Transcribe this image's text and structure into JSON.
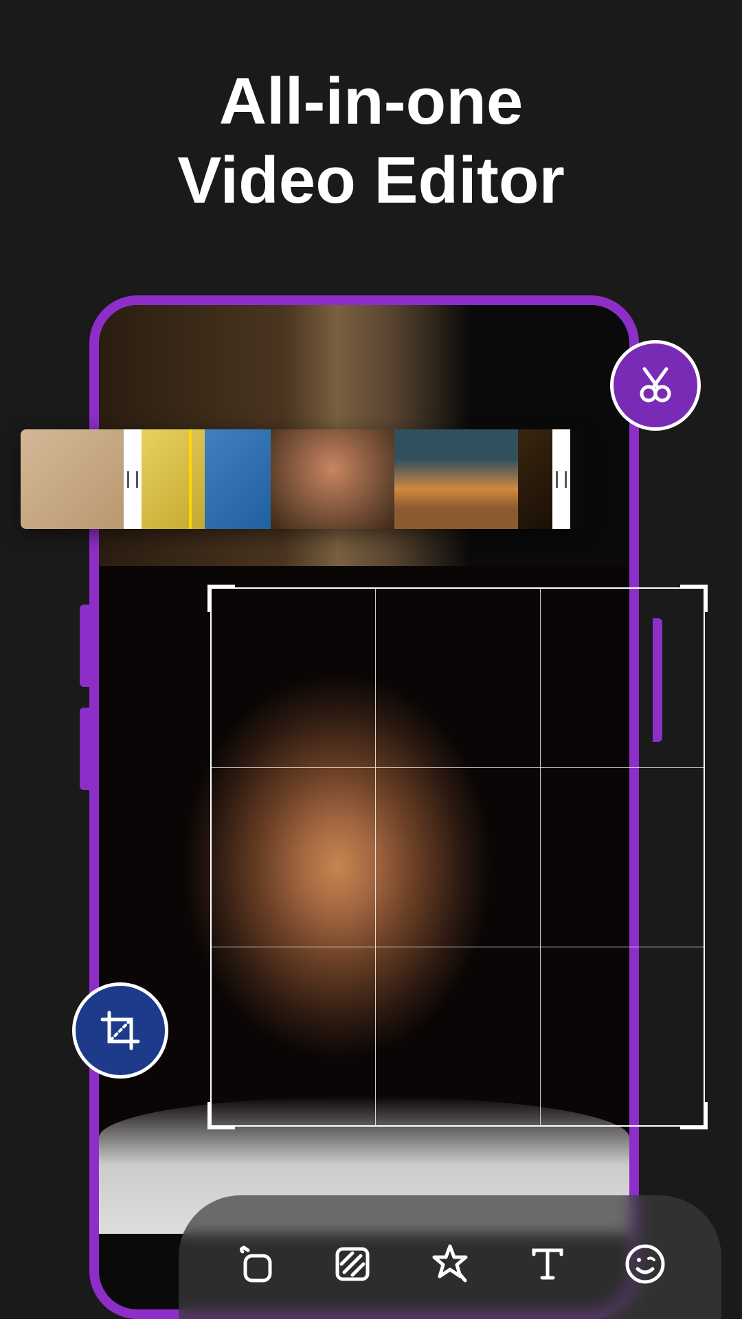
{
  "headline": {
    "line1": "All-in-one",
    "line2": "Video Editor"
  },
  "colors": {
    "accent_purple": "#8e2ec9",
    "badge_purple": "#7a2bb5",
    "badge_blue": "#1e3a8a",
    "scrubber": "#ffd700"
  },
  "timeline": {
    "clips": [
      {
        "id": "clip1",
        "desc": "person-sunglasses"
      },
      {
        "id": "clip2",
        "desc": "yellow-portrait"
      },
      {
        "id": "clip3",
        "desc": "blue-portrait"
      },
      {
        "id": "clip4",
        "desc": "curly-closeup"
      },
      {
        "id": "clip5",
        "desc": "yoga-sunset"
      },
      {
        "id": "clip6",
        "desc": "dark-clip"
      }
    ]
  },
  "badges": {
    "scissors": "cut-tool",
    "crop": "crop-tool"
  },
  "toolbar": {
    "items": [
      {
        "name": "rotate",
        "icon": "rotate-icon"
      },
      {
        "name": "filter",
        "icon": "filter-icon"
      },
      {
        "name": "effects",
        "icon": "star-icon"
      },
      {
        "name": "text",
        "icon": "text-icon"
      },
      {
        "name": "sticker",
        "icon": "smile-icon"
      }
    ]
  }
}
